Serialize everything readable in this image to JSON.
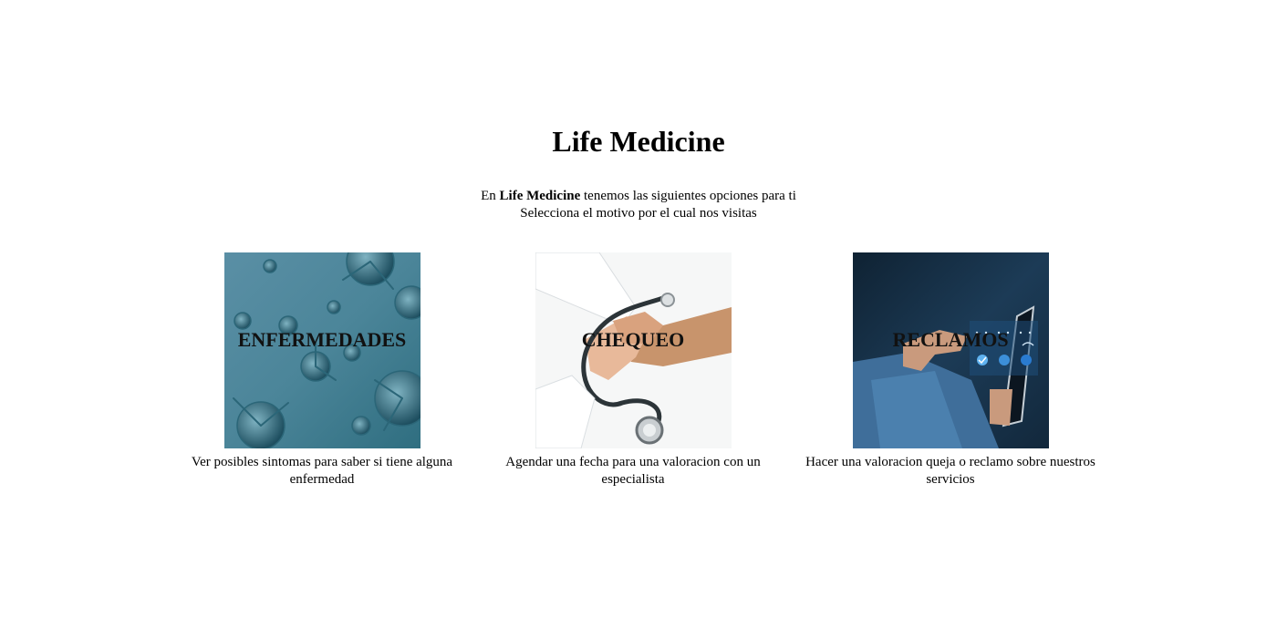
{
  "header": {
    "title": "Life Medicine"
  },
  "intro": {
    "prefix": "En ",
    "brand": "Life Medicine",
    "suffix": " tenemos las siguientes opciones para ti",
    "line2": "Selecciona el motivo por el cual nos visitas"
  },
  "cards": [
    {
      "label": "ENFERMEDADES",
      "description": "Ver posibles sintomas para saber si tiene alguna enfermedad",
      "image": "virus-image"
    },
    {
      "label": "CHEQUEO",
      "description": "Agendar una fecha para una valoracion con un especialista",
      "image": "stethoscope-handshake-image"
    },
    {
      "label": "RECLAMOS",
      "description": "Hacer una valoracion queja o reclamo sobre nuestros servicios",
      "image": "tablet-rating-image"
    }
  ]
}
